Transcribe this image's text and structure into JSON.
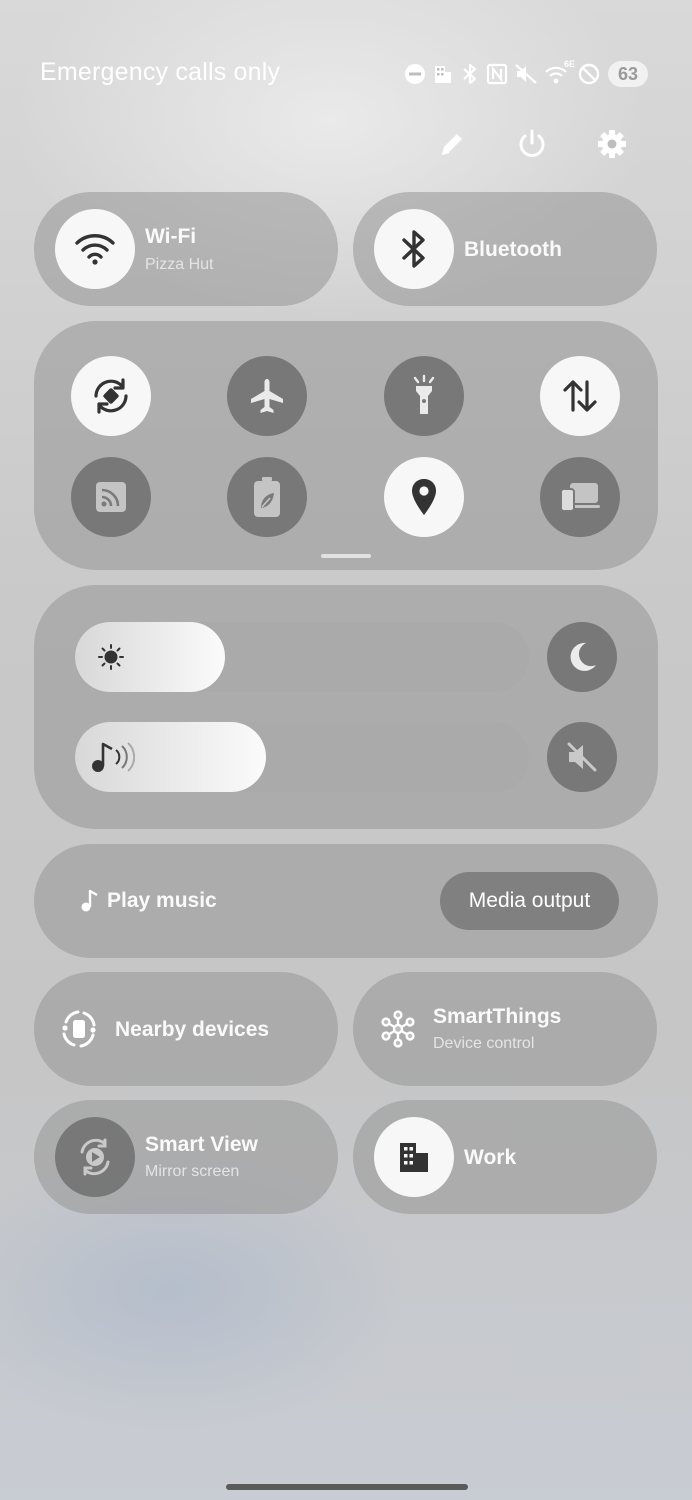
{
  "status_bar": {
    "carrier_text": "Emergency calls only",
    "battery_level": "63",
    "icons": [
      "do-not-disturb-icon",
      "work-profile-icon",
      "bluetooth-icon",
      "nfc-icon",
      "mute-icon",
      "wifi-6e-icon",
      "blocked-icon",
      "battery-icon"
    ],
    "wifi_badge": "6E"
  },
  "header_actions": [
    "edit-icon",
    "power-icon",
    "settings-icon"
  ],
  "wifi_tile": {
    "title": "Wi-Fi",
    "subtitle": "Pizza Hut",
    "state": "on"
  },
  "bluetooth_tile": {
    "title": "Bluetooth",
    "state": "on"
  },
  "quick_toggles": [
    {
      "name": "auto-rotate",
      "icon": "auto-rotate-icon",
      "state": "on"
    },
    {
      "name": "airplane-mode",
      "icon": "airplane-icon",
      "state": "off"
    },
    {
      "name": "flashlight",
      "icon": "flashlight-icon",
      "state": "off"
    },
    {
      "name": "mobile-data",
      "icon": "data-arrows-icon",
      "state": "on"
    },
    {
      "name": "cast",
      "icon": "cast-icon",
      "state": "off"
    },
    {
      "name": "power-saving",
      "icon": "battery-leaf-icon",
      "state": "off"
    },
    {
      "name": "location",
      "icon": "location-pin-icon",
      "state": "on"
    },
    {
      "name": "link-to-windows",
      "icon": "devices-icon",
      "state": "off"
    }
  ],
  "brightness": {
    "icon": "sun-icon",
    "level": 0.33
  },
  "volume": {
    "icon": "music-note-icon",
    "level": 0.42
  },
  "dark_mode": {
    "icon": "moon-icon",
    "state": "off"
  },
  "sound_mode": {
    "icon": "mute-icon",
    "state": "off"
  },
  "media": {
    "play_label": "Play music",
    "output_label": "Media output"
  },
  "nearby_devices": {
    "title": "Nearby devices"
  },
  "smartthings": {
    "title": "SmartThings",
    "subtitle": "Device control"
  },
  "smart_view": {
    "title": "Smart View",
    "subtitle": "Mirror screen",
    "state": "off"
  },
  "work": {
    "title": "Work",
    "state": "on"
  }
}
